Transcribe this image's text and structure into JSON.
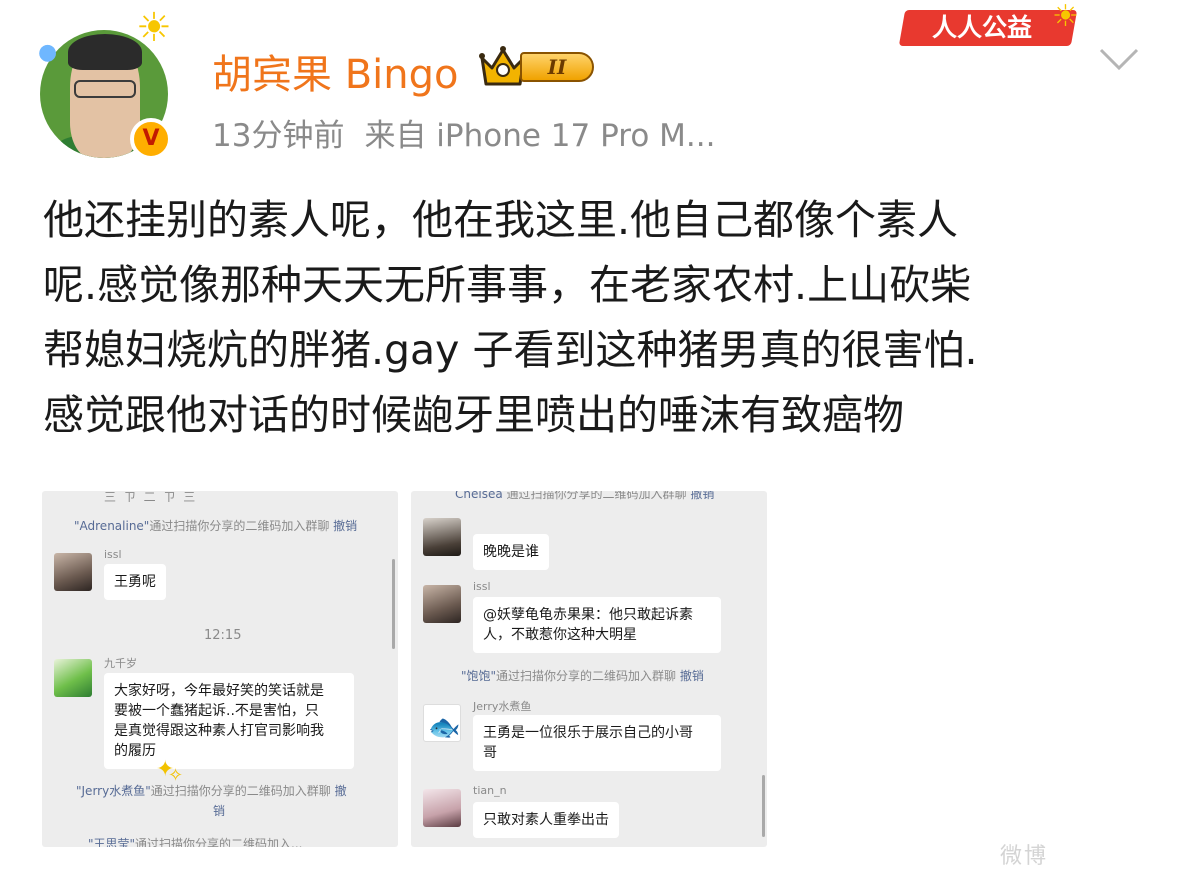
{
  "post": {
    "author_name": "胡宾果 Bingo",
    "level_badge": "II",
    "time": "13分钟前",
    "source": "来自 iPhone 17 Pro M...",
    "charity_badge": "人人公益",
    "text_lines": [
      "他还挂别的素人呢，他在我这里.他自己都像个素人",
      "呢.感觉像那种天天无所事事，在老家农村.上山砍柴",
      "帮媳妇烧炕的胖猪.gay 子看到这种猪男真的很害怕.",
      "感觉跟他对话的时候龅牙里喷出的唾沫有致癌物"
    ]
  },
  "images": [
    {
      "top_fragment": "三 ㄗ 二 ㄗ 三",
      "system_1": {
        "who": "\"Adrenaline\"",
        "text": "通过扫描你分享的二维码加入群聊",
        "revoke": "撤销"
      },
      "msg_1": {
        "sender": "issl",
        "text": "王勇呢"
      },
      "timestamp": "12:15",
      "msg_2": {
        "sender": "九千岁",
        "lines": [
          "大家好呀，今年最好笑的笑话就是",
          "要被一个蠢猪起诉..不是害怕，只",
          "是真觉得跟这种素人打官司影响我",
          "的履历"
        ]
      },
      "system_2": {
        "who": "\"Jerry水煮鱼\"",
        "text": "通过扫描你分享的二维码加入群聊",
        "revoke": "撤",
        "revoke_2": "销"
      },
      "system_3": {
        "who": "\"王思莹\"",
        "text": "通过扫描你分享的二维码加入..."
      }
    },
    {
      "system_0": {
        "who": "Chelsea",
        "text": "通过扫描你分享的二维码加入群聊",
        "revoke": "撤销"
      },
      "msg_1": {
        "text": "晚晚是谁"
      },
      "msg_2": {
        "sender": "issl",
        "lines": [
          "@妖孽龟龟赤果果：他只敢起诉素",
          "人，不敢惹你这种大明星"
        ]
      },
      "system_1": {
        "who": "\"饱饱\"",
        "text": "通过扫描你分享的二维码加入群聊",
        "revoke": "撤销"
      },
      "msg_3": {
        "sender": "Jerry水煮鱼",
        "lines": [
          "王勇是一位很乐于展示自己的小哥",
          "哥"
        ]
      },
      "msg_4": {
        "sender": "tian_n",
        "text": "只敢对素人重拳出击"
      }
    }
  ],
  "watermark": "微博"
}
